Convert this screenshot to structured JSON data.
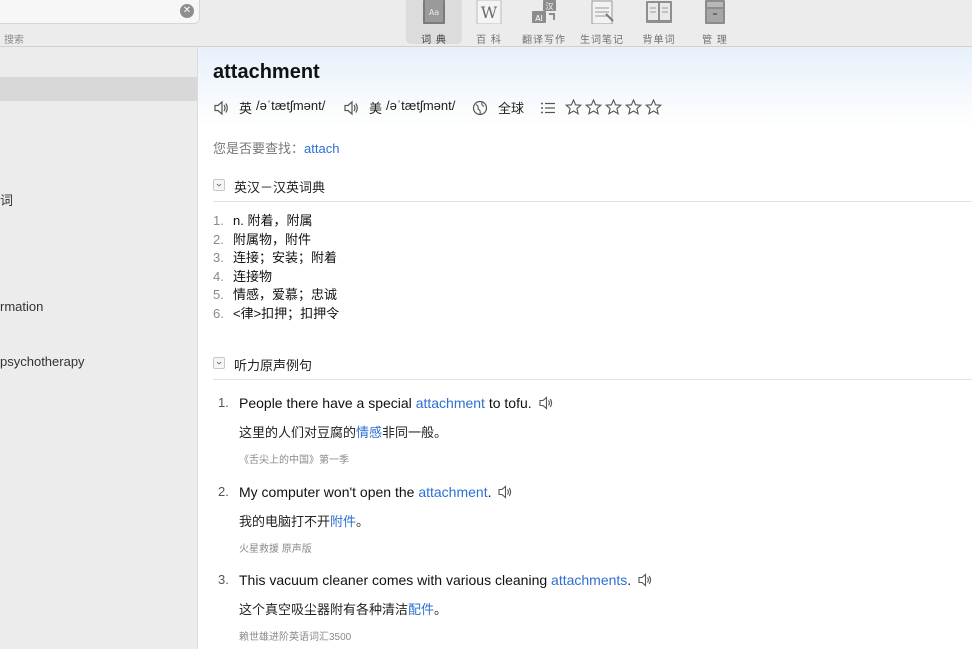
{
  "toolbar": {
    "search_label": "搜索",
    "tools": [
      {
        "label": "词 典",
        "icon": "dictionary-icon",
        "active": true
      },
      {
        "label": "百 科",
        "icon": "wikipedia-icon",
        "active": false
      },
      {
        "label": "翻译写作",
        "icon": "translate-icon",
        "active": false
      },
      {
        "label": "生词笔记",
        "icon": "notes-icon",
        "active": false
      },
      {
        "label": "背单词",
        "icon": "book-icon",
        "active": false
      },
      {
        "label": "管 理",
        "icon": "manage-icon",
        "active": false
      }
    ]
  },
  "sidebar": {
    "items": [
      {
        "label": "词"
      },
      {
        "label": "rmation"
      },
      {
        "label": "psychotherapy"
      }
    ]
  },
  "entry": {
    "word": "attachment",
    "uk_label": "英",
    "uk_phonetic": "/əˈtætʃmənt/",
    "us_label": "美",
    "us_phonetic": "/əˈtætʃmənt/",
    "global_label": "全球",
    "stars_total": 5,
    "stars_filled": 0
  },
  "suggestion": {
    "prefix": "您是否要查找：",
    "word": "attach"
  },
  "dict_section": {
    "title": "英汉－汉英词典",
    "definitions": [
      {
        "num": "1.",
        "text": "n. 附着，附属"
      },
      {
        "num": "2.",
        "text": "附属物，附件"
      },
      {
        "num": "3.",
        "text": "连接；安装；附着"
      },
      {
        "num": "4.",
        "text": "连接物"
      },
      {
        "num": "5.",
        "text": "情感，爱慕；忠诚"
      },
      {
        "num": "6.",
        "text": "<律>扣押；扣押令"
      }
    ]
  },
  "examples_section": {
    "title": "听力原声例句",
    "examples": [
      {
        "num": "1.",
        "en_pre": "People there have a special ",
        "en_hl": "attachment",
        "en_post": " to tofu.",
        "zh_pre": "这里的人们对豆腐的",
        "zh_hl": "情感",
        "zh_post": "非同一般。",
        "source": "《舌尖上的中国》第一季"
      },
      {
        "num": "2.",
        "en_pre": "My computer won't open the ",
        "en_hl": "attachment",
        "en_post": ".",
        "zh_pre": "我的电脑打不开",
        "zh_hl": "附件",
        "zh_post": "。",
        "source": "火星救援 原声版"
      },
      {
        "num": "3.",
        "en_pre": "This vacuum cleaner comes with various cleaning ",
        "en_hl": "attachments",
        "en_post": ".",
        "zh_pre": "这个真空吸尘器附有各种清洁",
        "zh_hl": "配件",
        "zh_post": "。",
        "source": "赖世雄进阶英语词汇3500"
      }
    ]
  },
  "colors": {
    "link": "#2d6fd2",
    "toolbar_bg": "#ececec",
    "sidebar_bg": "#ececec",
    "sidebar_selected": "#d8d8d8"
  }
}
